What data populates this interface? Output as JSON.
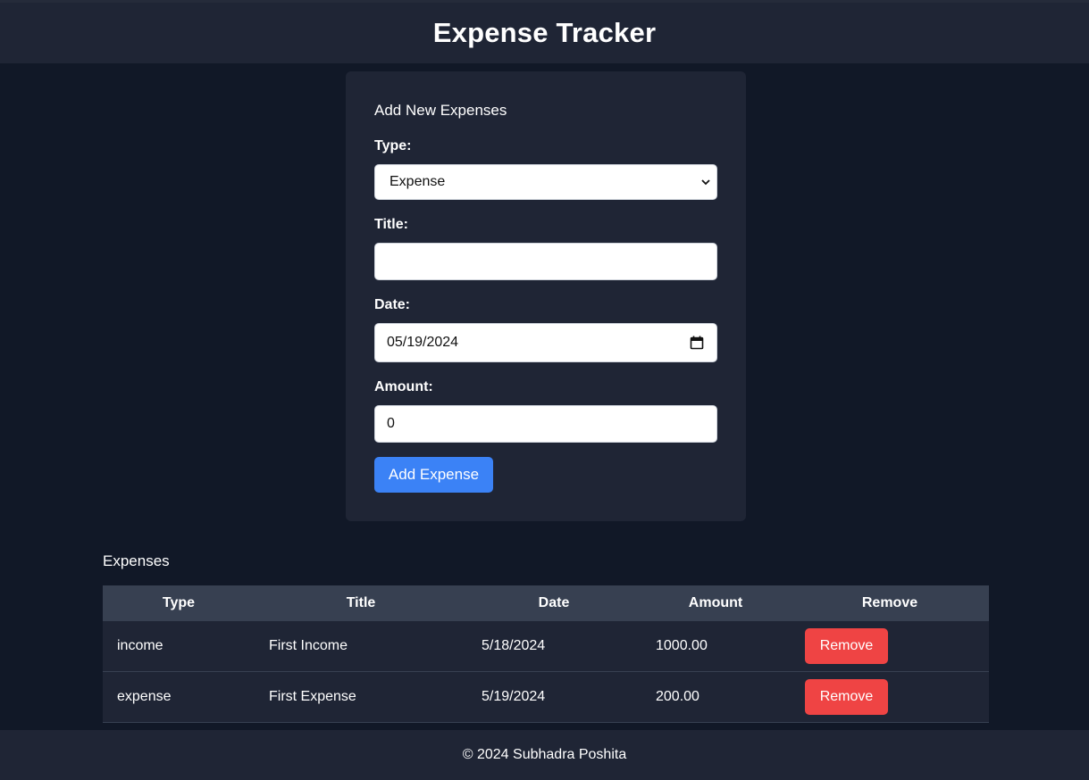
{
  "header": {
    "title": "Expense Tracker"
  },
  "form": {
    "heading": "Add New Expenses",
    "type_label": "Type:",
    "type_value": "Expense",
    "title_label": "Title:",
    "title_value": "",
    "date_label": "Date:",
    "date_value": "05/19/2024",
    "amount_label": "Amount:",
    "amount_value": "0",
    "submit_label": "Add Expense"
  },
  "list": {
    "heading": "Expenses",
    "columns": [
      "Type",
      "Title",
      "Date",
      "Amount",
      "Remove"
    ],
    "rows": [
      {
        "type": "income",
        "title": "First Income",
        "date": "5/18/2024",
        "amount": "1000.00",
        "action": "Remove"
      },
      {
        "type": "expense",
        "title": "First Expense",
        "date": "5/19/2024",
        "amount": "200.00",
        "action": "Remove"
      }
    ]
  },
  "footer": {
    "text": "© 2024 Subhadra Poshita"
  },
  "colors": {
    "background": "#111827",
    "panel": "#1f2535",
    "table_header": "#374051",
    "primary": "#3b82f6",
    "danger": "#ef4444"
  },
  "icons": {
    "select": "chevron-down-icon",
    "date": "calendar-icon"
  }
}
